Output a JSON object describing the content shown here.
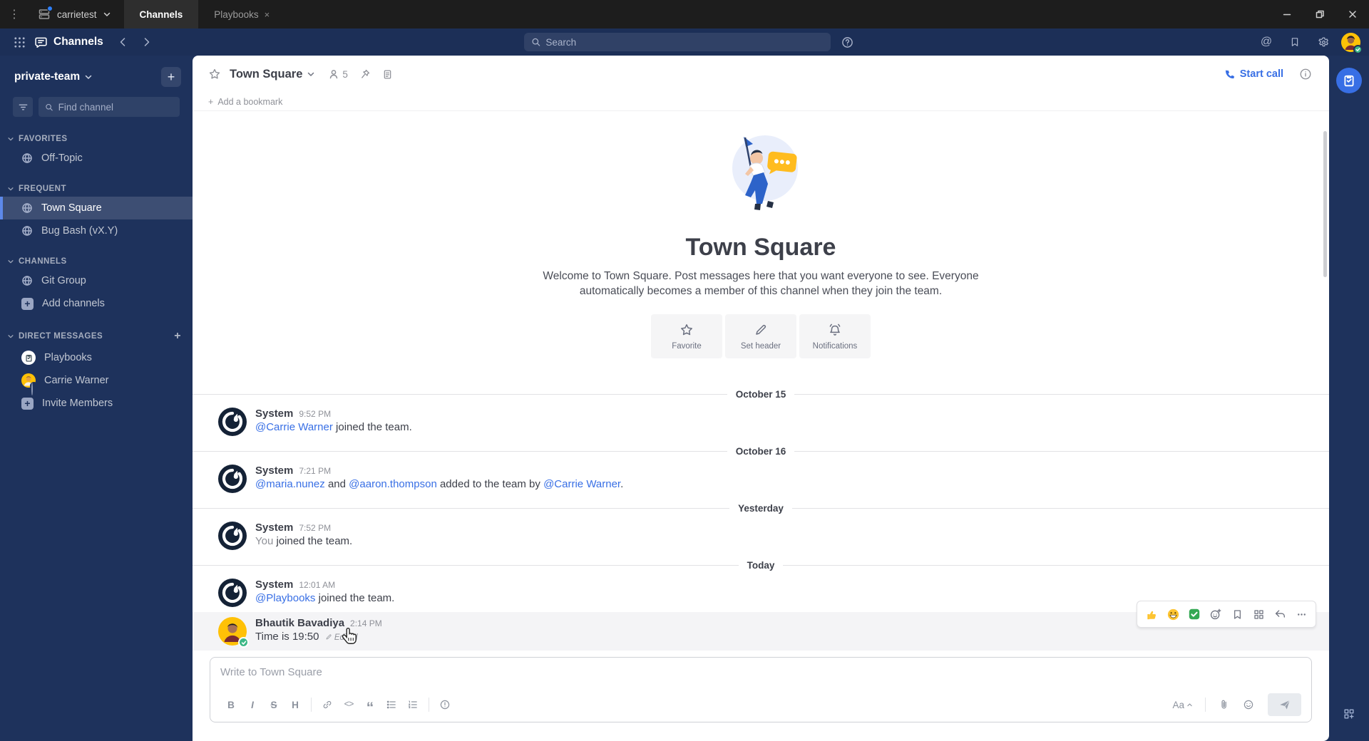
{
  "window": {
    "server_name": "carrietest",
    "tabs": [
      {
        "label": "Channels"
      },
      {
        "label": "Playbooks"
      }
    ]
  },
  "glyphs": {
    "menu": "⋮",
    "close_tab": "×",
    "at": "@",
    "ellipsis": "…",
    "code": "<>",
    "quote": "“",
    "plus": "+",
    "aa": "Aa",
    "bold": "B",
    "italic": "I",
    "strike": "S",
    "heading": "H"
  },
  "header": {
    "product_name": "Channels",
    "search_placeholder": "Search"
  },
  "sidebar": {
    "team_name": "private-team",
    "find_channel_placeholder": "Find channel",
    "sections": [
      {
        "label": "FAVORITES",
        "items": [
          {
            "label": "Off-Topic"
          }
        ]
      },
      {
        "label": "FREQUENT",
        "items": [
          {
            "label": "Town Square"
          },
          {
            "label": "Bug Bash (vX.Y)"
          }
        ]
      },
      {
        "label": "CHANNELS",
        "items": [
          {
            "label": "Git Group"
          },
          {
            "label": "Add channels"
          }
        ]
      },
      {
        "label": "DIRECT MESSAGES",
        "items": [
          {
            "label": "Playbooks"
          },
          {
            "label": "Carrie Warner"
          },
          {
            "label": "Invite Members"
          }
        ]
      }
    ]
  },
  "channel_header": {
    "title": "Town Square",
    "member_count": "5",
    "start_call_label": "Start call"
  },
  "bookmark_bar": {
    "add_label": "Add a bookmark"
  },
  "intro": {
    "heading": "Town Square",
    "description": "Welcome to Town Square. Post messages here that you want everyone to see. Everyone automatically becomes a member of this channel when they join the team.",
    "actions": [
      {
        "label": "Favorite"
      },
      {
        "label": "Set header"
      },
      {
        "label": "Notifications"
      }
    ]
  },
  "timeline": {
    "dividers": [
      "October 15",
      "October 16",
      "Yesterday",
      "Today"
    ],
    "posts": [
      {
        "sender": "System",
        "time": "9:52 PM",
        "m1": "@Carrie Warner",
        "t1": " joined the team."
      },
      {
        "sender": "System",
        "time": "7:21 PM",
        "m1": "@maria.nunez",
        "t1": " and ",
        "m2": "@aaron.thompson",
        "t2": " added to the team by ",
        "m3": "@Carrie Warner",
        "t3": "."
      },
      {
        "sender": "System",
        "time": "7:52 PM",
        "muted": "You",
        "t1": " joined the team."
      },
      {
        "sender": "System",
        "time": "12:01 AM",
        "m1": "@Playbooks",
        "t1": " joined the team."
      },
      {
        "sender": "Bhautik Bavadiya",
        "time": "2:14 PM",
        "t1": "Time is 19:50",
        "edited": "Edited"
      }
    ]
  },
  "composer": {
    "placeholder": "Write to Town Square",
    "formatting_label": "Aa"
  },
  "colors": {
    "accent_blue": "#386fe5",
    "sidebar_bg": "#1e325c",
    "titlebar_bg": "#1d1d1d",
    "online_green": "#3db887",
    "avatar_yellow": "#ffc107",
    "active_border": "#5d89ea"
  }
}
